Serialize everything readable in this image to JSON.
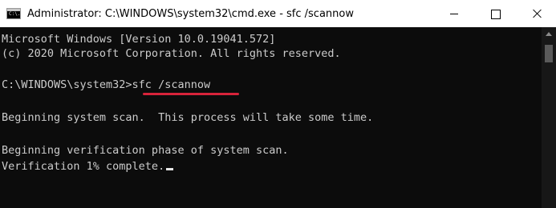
{
  "window": {
    "title": "Administrator: C:\\WINDOWS\\system32\\cmd.exe - sfc  /scannow",
    "app_icon_glyph": "C:\\."
  },
  "console": {
    "lines": [
      "Microsoft Windows [Version 10.0.19041.572]",
      "(c) 2020 Microsoft Corporation. All rights reserved.",
      "C:\\WINDOWS\\system32>sfc /scannow",
      "Beginning system scan.  This process will take some time.",
      "Beginning verification phase of system scan.",
      "Verification 1% complete."
    ]
  },
  "colors": {
    "console_bg": "#0c0c0c",
    "console_text": "#cccccc",
    "highlight_underline": "#d8233a",
    "titlebar_bg": "#ffffff"
  },
  "icons": {
    "minimize": "minimize-icon",
    "maximize": "maximize-icon",
    "close": "close-icon",
    "app": "cmd-icon"
  }
}
